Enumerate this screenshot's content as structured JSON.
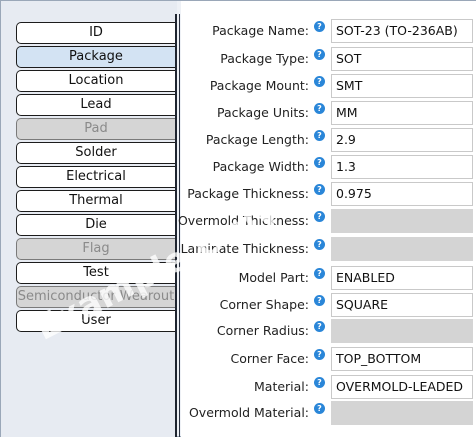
{
  "tabs": [
    {
      "label": "ID",
      "state": "normal"
    },
    {
      "label": "Package",
      "state": "selected"
    },
    {
      "label": "Location",
      "state": "normal"
    },
    {
      "label": "Lead",
      "state": "normal"
    },
    {
      "label": "Pad",
      "state": "disabled"
    },
    {
      "label": "Solder",
      "state": "normal"
    },
    {
      "label": "Electrical",
      "state": "normal"
    },
    {
      "label": "Thermal",
      "state": "normal"
    },
    {
      "label": "Die",
      "state": "normal"
    },
    {
      "label": "Flag",
      "state": "disabled"
    },
    {
      "label": "Test",
      "state": "normal"
    },
    {
      "label": "Semiconductor Wearout",
      "state": "disabled"
    },
    {
      "label": "User",
      "state": "normal"
    }
  ],
  "fields": [
    {
      "label": "Package Name:",
      "value": "SOT-23 (TO-236AB)"
    },
    {
      "label": "Package Type:",
      "value": "SOT"
    },
    {
      "label": "Package Mount:",
      "value": "SMT"
    },
    {
      "label": "Package Units:",
      "value": "MM"
    },
    {
      "label": "Package Length:",
      "value": "2.9"
    },
    {
      "label": "Package Width:",
      "value": "1.3"
    },
    {
      "label": "Package Thickness:",
      "value": "0.975"
    },
    {
      "label": "Overmold Thickness:",
      "value": ""
    },
    {
      "label": "Laminate Thickness:",
      "value": ""
    },
    {
      "label": "Model Part:",
      "value": "ENABLED"
    },
    {
      "label": "Corner Shape:",
      "value": "SQUARE"
    },
    {
      "label": "Corner Radius:",
      "value": ""
    },
    {
      "label": "Corner Face:",
      "value": "TOP_BOTTOM"
    },
    {
      "label": "Material:",
      "value": "OVERMOLD-LEADED"
    },
    {
      "label": "Overmold Material:",
      "value": ""
    }
  ],
  "help_icon_glyph": "?",
  "help_icon_name": "help-icon",
  "watermark": "Example Only",
  "colors": {
    "selected_tab": "#d3e3f3",
    "disabled_fill": "#d4d4d4",
    "help_icon": "#2a86d8"
  }
}
